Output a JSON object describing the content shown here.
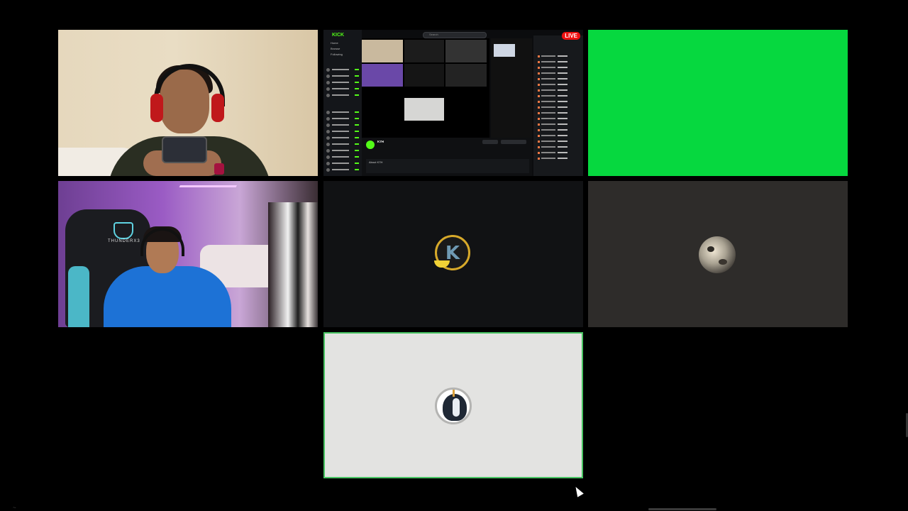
{
  "meeting": {
    "tiles": [
      {
        "id": "participant-1",
        "type": "webcam"
      },
      {
        "id": "screenshare",
        "type": "screen"
      },
      {
        "id": "participant-3",
        "type": "greenscreen"
      },
      {
        "id": "participant-4",
        "type": "webcam"
      },
      {
        "id": "participant-5",
        "type": "avatar"
      },
      {
        "id": "participant-6",
        "type": "avatar"
      },
      {
        "id": "participant-7",
        "type": "avatar"
      }
    ]
  },
  "screenshare": {
    "logo": "KICK",
    "nav": [
      "Home",
      "Browse",
      "Following"
    ],
    "search_placeholder": "Search",
    "live_badge": "LIVE",
    "stream_name": "K7H",
    "about_label": "About K7H"
  },
  "tile4": {
    "chair_text": "THUNDERX3"
  },
  "footer": {
    "text": "~ "
  },
  "colors": {
    "greenscreen": "#06d83f",
    "active_speaker_border": "#49c463",
    "kick_green": "#53fc18",
    "live_red": "#e11111"
  }
}
